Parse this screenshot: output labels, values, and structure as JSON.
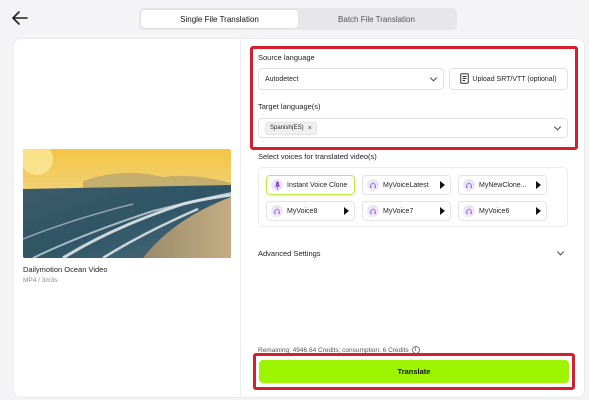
{
  "tabs": [
    {
      "label": "Single File Translation",
      "active": true
    },
    {
      "label": "Batch File Translation",
      "active": false
    }
  ],
  "video": {
    "title": "Dailymotion Ocean Video",
    "meta": "MP4 / 3m3s"
  },
  "source_language": {
    "label": "Source language",
    "value": "Autodetect"
  },
  "upload": {
    "label": "Upload SRT/VTT (optional)"
  },
  "target_language": {
    "label": "Target language(s)",
    "chips": [
      "Spanish(ES)"
    ]
  },
  "voices": {
    "label": "Select voices for translated video(s)",
    "items": [
      {
        "name": "Instant Voice Clone",
        "selected": true
      },
      {
        "name": "MyVoiceLatest"
      },
      {
        "name": "MyNewClone..."
      },
      {
        "name": "MyVoice8"
      },
      {
        "name": "MyVoice7"
      },
      {
        "name": "MyVoice6"
      }
    ]
  },
  "advanced": {
    "label": "Advanced Settings"
  },
  "credits": {
    "text": "Remaining: 4946.64 Credits; consumption: 6 Credits"
  },
  "translate_button": {
    "label": "Translate"
  },
  "colors": {
    "accent": "#9ef500",
    "highlight": "#d61f2d"
  }
}
